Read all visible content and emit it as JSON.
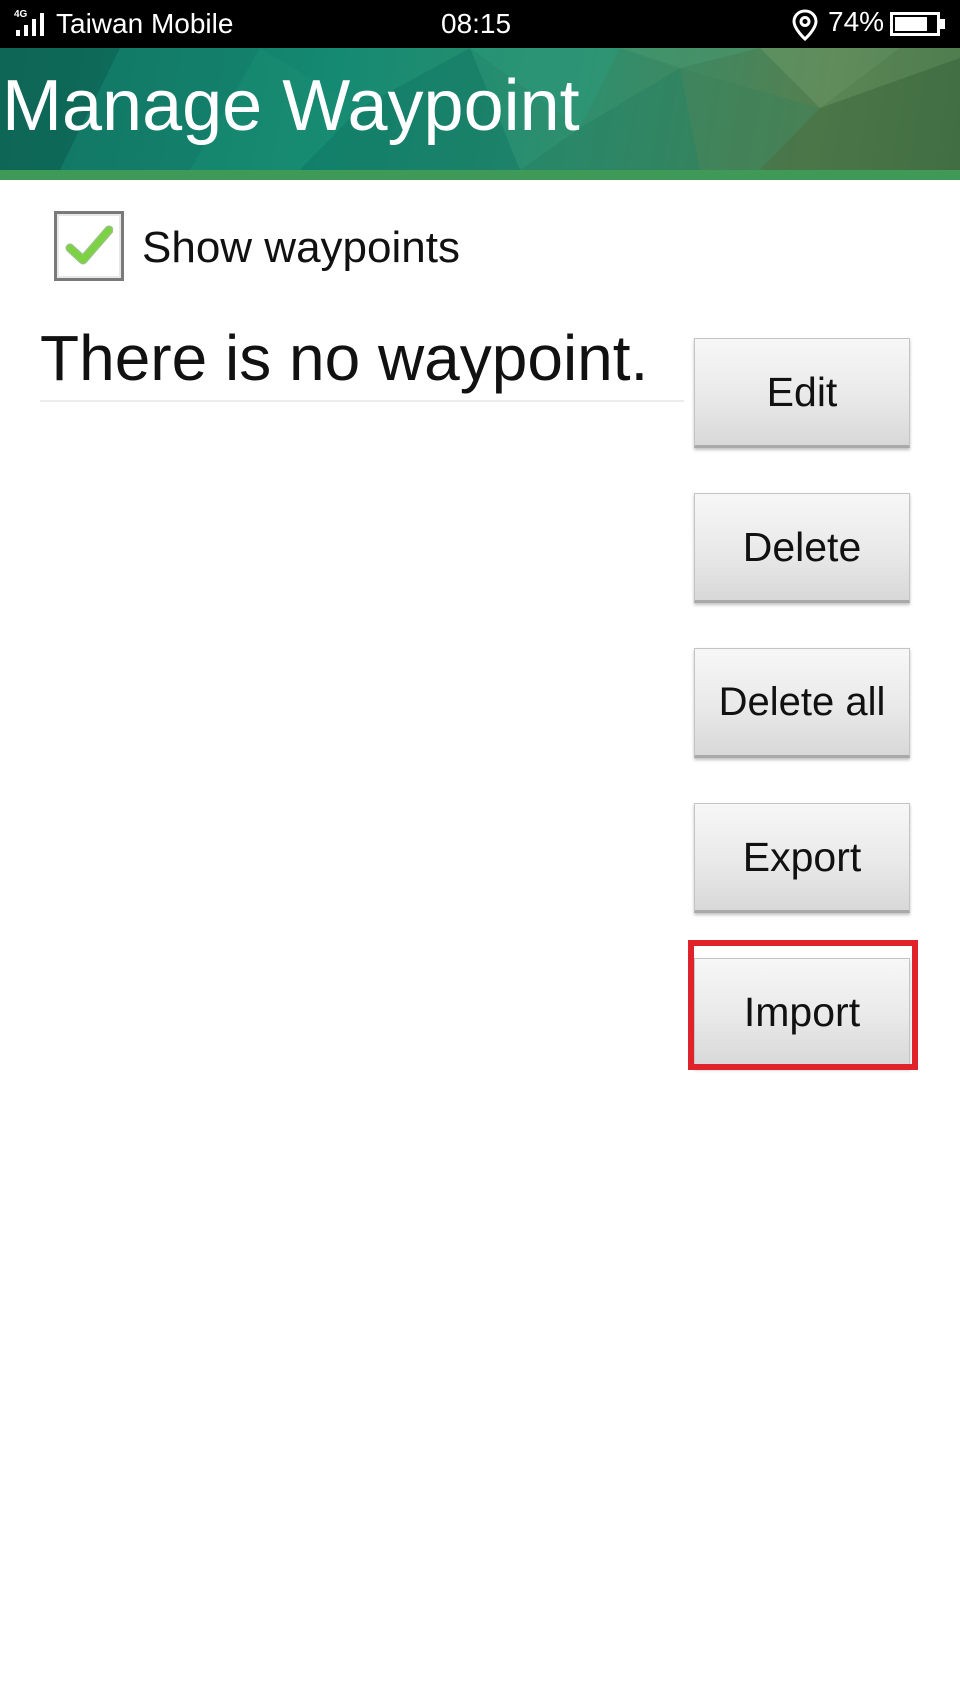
{
  "status_bar": {
    "network_type": "4G",
    "carrier": "Taiwan Mobile",
    "time": "08:15",
    "battery_percent": "74%",
    "icons": [
      "signal-icon",
      "location-icon",
      "battery-icon"
    ]
  },
  "header": {
    "title": "Manage Waypoint"
  },
  "settings": {
    "show_waypoints_label": "Show waypoints",
    "show_waypoints_checked": true
  },
  "waypoints": {
    "empty_message": "There is no waypoint."
  },
  "actions": {
    "edit_label": "Edit",
    "delete_label": "Delete",
    "delete_all_label": "Delete all",
    "export_label": "Export",
    "import_label": "Import"
  },
  "colors": {
    "header_green": "#158a72",
    "checkmark_green": "#6cc43a",
    "highlight_red": "#e0232b"
  }
}
